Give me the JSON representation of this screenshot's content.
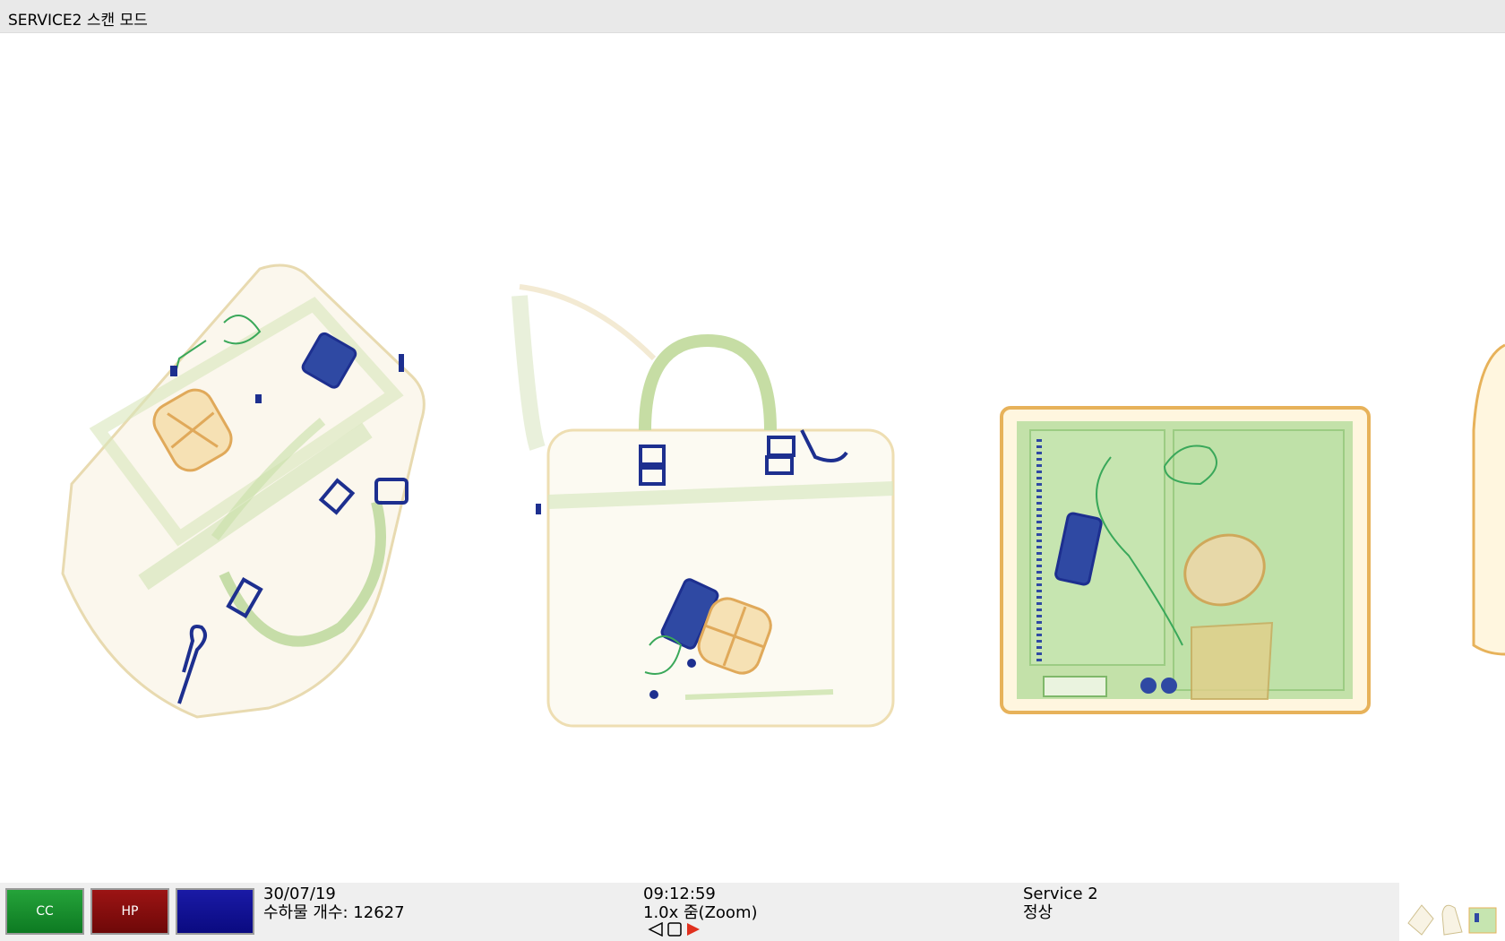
{
  "window": {
    "title": "SERVICE2 스캔 모드"
  },
  "scan": {
    "items": [
      "bag-diagonal",
      "briefcase",
      "tray"
    ]
  },
  "status": {
    "buttons": {
      "cc_label": "CC",
      "hp_label": "HP",
      "blank_label": ""
    },
    "date": "30/07/19",
    "bag_count": "수하물 개수: 12627",
    "time": "09:12:59",
    "zoom": "1.0x 줌(Zoom)",
    "user": "Service 2",
    "state": "정상"
  },
  "nav_icons": [
    "prev-triangle-icon",
    "stop-square-icon",
    "next-triangle-icon"
  ],
  "colors": {
    "green_btn": "#1e9a34",
    "red_btn": "#8c1010",
    "blue_btn": "#12129a",
    "organic": "#d9a25a",
    "inorganic": "#7fb86a",
    "metal": "#1d2f8f"
  }
}
